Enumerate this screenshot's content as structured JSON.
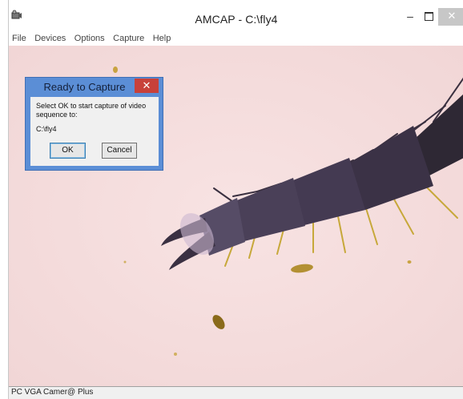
{
  "window": {
    "title": "AMCAP - C:\\fly4",
    "minimize_symbol": "–",
    "close_symbol": "✕",
    "icon": "camera-icon"
  },
  "menu": {
    "items": [
      "File",
      "Devices",
      "Options",
      "Capture",
      "Help"
    ]
  },
  "statusbar": {
    "text": "PC VGA Camer@ Plus"
  },
  "dialog": {
    "title": "Ready to Capture",
    "close_symbol": "✕",
    "message": "Select OK to start capture of video sequence to:",
    "path": "C:\\fly4",
    "ok_label": "OK",
    "cancel_label": "Cancel"
  },
  "colors": {
    "video_background": "#f6dede",
    "dialog_frame": "#5b8ed6",
    "dialog_close": "#c8413a"
  }
}
